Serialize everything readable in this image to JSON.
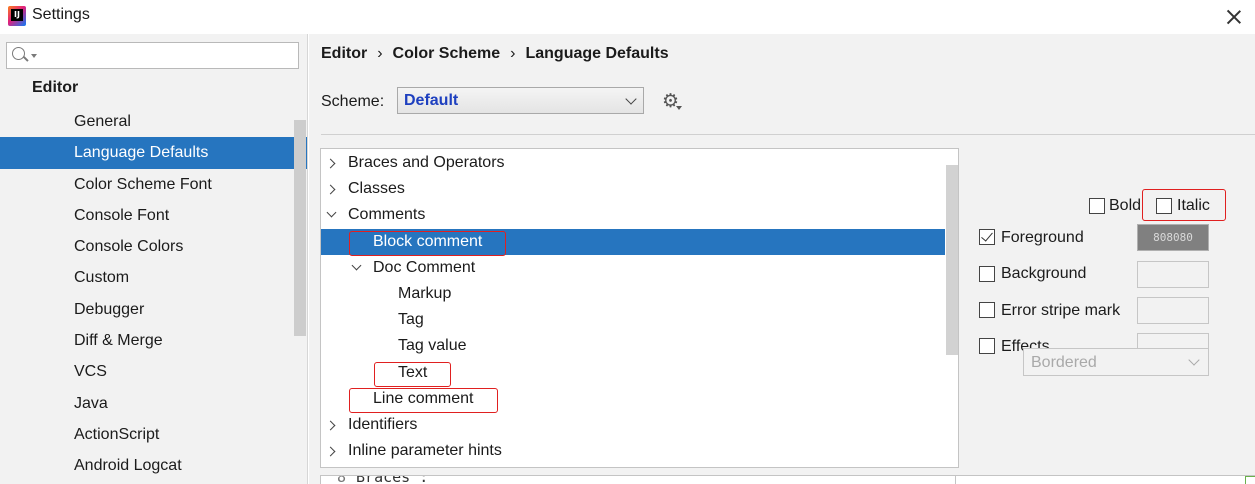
{
  "window": {
    "title": "Settings"
  },
  "sidebar": {
    "search_value": "",
    "section": "Editor",
    "items": [
      {
        "label": "General"
      },
      {
        "label": "Language Defaults",
        "selected": true
      },
      {
        "label": "Color Scheme Font"
      },
      {
        "label": "Console Font"
      },
      {
        "label": "Console Colors"
      },
      {
        "label": "Custom"
      },
      {
        "label": "Debugger"
      },
      {
        "label": "Diff & Merge"
      },
      {
        "label": "VCS"
      },
      {
        "label": "Java"
      },
      {
        "label": "ActionScript"
      },
      {
        "label": "Android Logcat"
      }
    ]
  },
  "breadcrumb": {
    "parts": [
      "Editor",
      "Color Scheme",
      "Language Defaults"
    ],
    "separator": "›"
  },
  "scheme": {
    "label": "Scheme:",
    "value": "Default"
  },
  "tree": {
    "rows": [
      {
        "label": "Braces and Operators",
        "level": 0,
        "arrow": "right"
      },
      {
        "label": "Classes",
        "level": 0,
        "arrow": "right"
      },
      {
        "label": "Comments",
        "level": 0,
        "arrow": "down"
      },
      {
        "label": "Block comment",
        "level": 1,
        "arrow": null,
        "selected": true,
        "highlighted": true
      },
      {
        "label": "Doc Comment",
        "level": 1,
        "arrow": "down"
      },
      {
        "label": "Markup",
        "level": 2,
        "arrow": null
      },
      {
        "label": "Tag",
        "level": 2,
        "arrow": null
      },
      {
        "label": "Tag value",
        "level": 2,
        "arrow": null
      },
      {
        "label": "Text",
        "level": 2,
        "arrow": null,
        "highlighted": true
      },
      {
        "label": "Line comment",
        "level": 1,
        "arrow": null,
        "highlighted": true
      },
      {
        "label": "Identifiers",
        "level": 0,
        "arrow": "right"
      },
      {
        "label": "Inline parameter hints",
        "level": 0,
        "arrow": "right"
      }
    ]
  },
  "options": {
    "bold": {
      "label": "Bold",
      "checked": false
    },
    "italic": {
      "label": "Italic",
      "checked": false,
      "highlighted": true
    },
    "foreground": {
      "label": "Foreground",
      "checked": true,
      "color_hex": "808080",
      "color": "#808080"
    },
    "background": {
      "label": "Background",
      "checked": false
    },
    "error_stripe": {
      "label": "Error stripe mark",
      "checked": false
    },
    "effects": {
      "label": "Effects",
      "checked": false,
      "style": "Bordered"
    }
  },
  "preview": {
    "line_number": "8",
    "text": "Braces :"
  },
  "colors": {
    "selection": "#2675bf",
    "highlight_box": "#e02020",
    "scheme_value": "#1d3fbf"
  }
}
